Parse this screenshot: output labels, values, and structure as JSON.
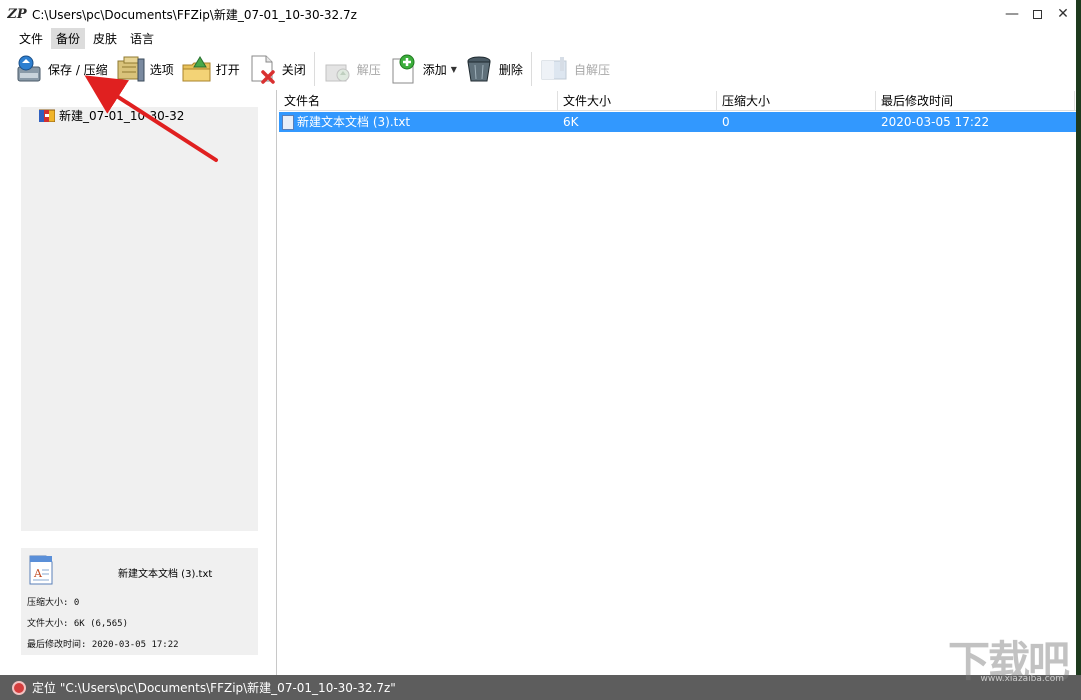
{
  "window": {
    "title": "C:\\Users\\pc\\Documents\\FFZip\\新建_07-01_10-30-32.7z",
    "app_logo": "ZP",
    "controls": {
      "minimize": "—",
      "close": "✕"
    }
  },
  "menu": [
    "文件",
    "备份",
    "皮肤",
    "语言"
  ],
  "toolbar": {
    "save": "保存 / 压缩",
    "options": "选项",
    "open": "打开",
    "close": "关闭",
    "extract": "解压",
    "add": "添加",
    "delete": "删除",
    "self_extract": "自解压"
  },
  "tree": {
    "archive_name": "新建_07-01_10-30-32"
  },
  "info_panel": {
    "file_name": "新建文本文档 (3).txt",
    "compressed_size": "压缩大小: 0",
    "file_size": "文件大小: 6K (6,565)",
    "modified": "最后修改时间: 2020-03-05 17:22"
  },
  "file_list": {
    "columns": [
      "文件名",
      "文件大小",
      "压缩大小",
      "最后修改时间"
    ],
    "rows": [
      {
        "name": "新建文本文档 (3).txt",
        "size": "6K",
        "compressed": "0",
        "modified": "2020-03-05 17:22"
      }
    ]
  },
  "status": {
    "text": "定位 \"C:\\Users\\pc\\Documents\\FFZip\\新建_07-01_10-30-32.7z\""
  },
  "watermark": {
    "big": "下载吧",
    "small": "www.xiazaiba.com"
  },
  "colors": {
    "selection": "#3298fe",
    "statusbar": "#5d5d5d",
    "arrow": "#e02020"
  }
}
